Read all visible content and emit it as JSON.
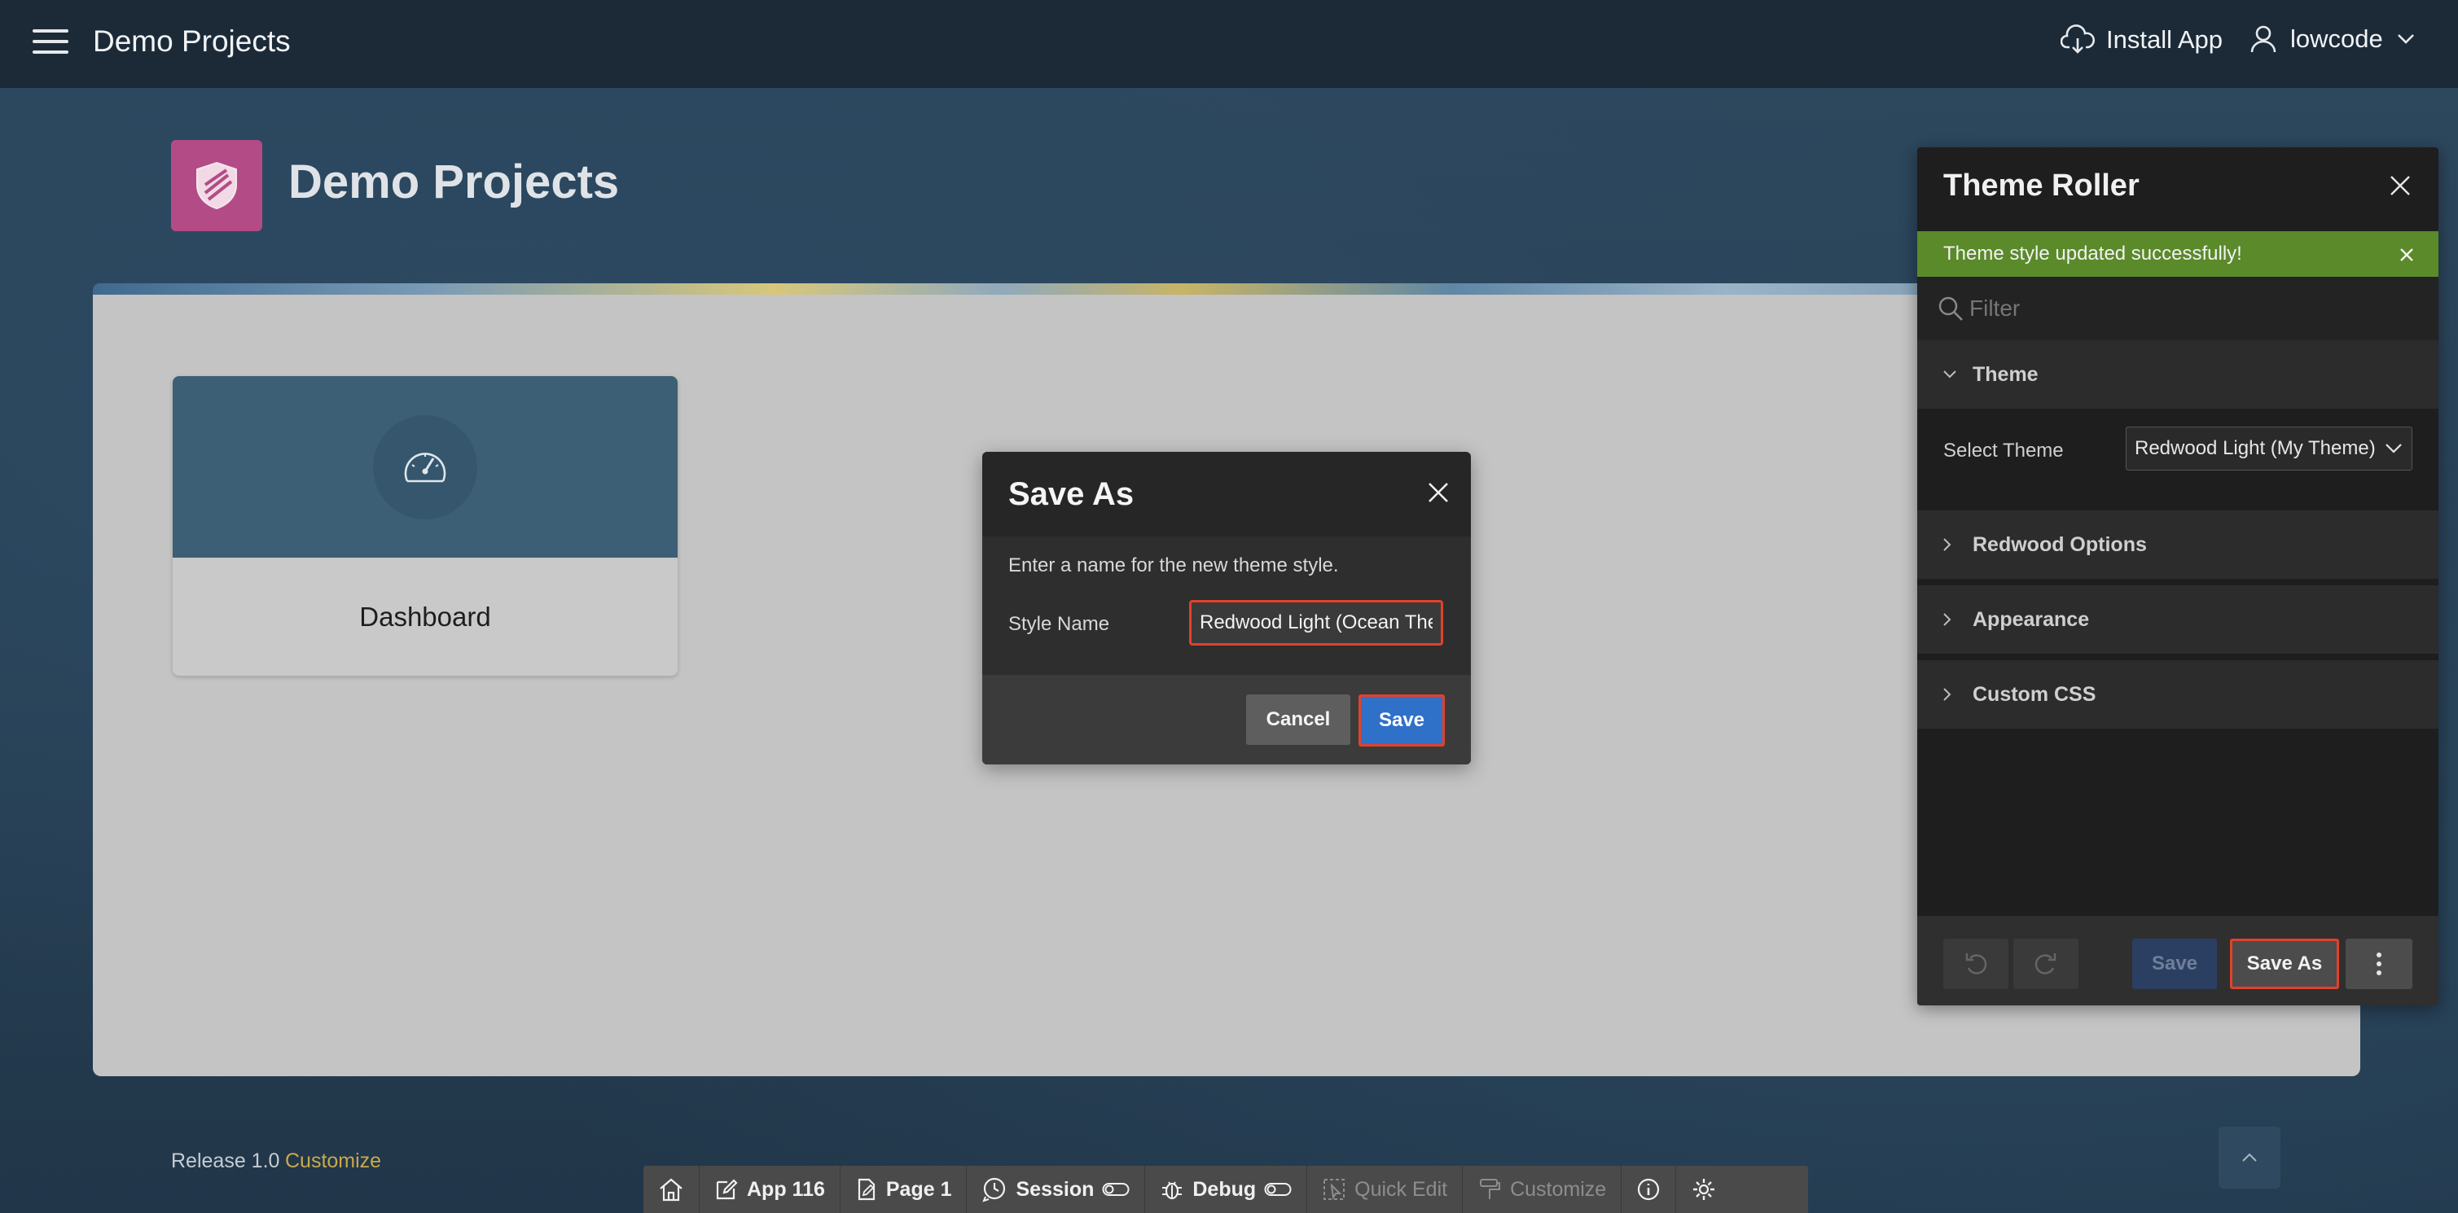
{
  "header": {
    "app_title": "Demo Projects",
    "install_app": "Install App",
    "username": "lowcode"
  },
  "page": {
    "title": "Demo Projects",
    "card_label": "Dashboard"
  },
  "footer": {
    "release": "Release 1.0",
    "customize": "Customize"
  },
  "dev_toolbar": {
    "app": "App 116",
    "page": "Page 1",
    "session": "Session",
    "debug": "Debug",
    "quick_edit": "Quick Edit",
    "customize": "Customize"
  },
  "dialog": {
    "title": "Save As",
    "description": "Enter a name for the new theme style.",
    "style_name_label": "Style Name",
    "style_name_value": "Redwood Light (Ocean Theme)",
    "cancel": "Cancel",
    "save": "Save"
  },
  "theme_roller": {
    "title": "Theme Roller",
    "alert": "Theme style updated successfully!",
    "filter_placeholder": "Filter",
    "sections": {
      "theme": "Theme",
      "redwood_options": "Redwood Options",
      "appearance": "Appearance",
      "custom_css": "Custom CSS"
    },
    "select_theme_label": "Select Theme",
    "select_theme_value": "Redwood Light (My Theme)",
    "footer": {
      "save": "Save",
      "save_as": "Save As"
    }
  },
  "colors": {
    "header_bg": "#1c2a38",
    "logo_tile": "#b34b86",
    "alert_success": "#5a8a2a",
    "primary_button": "#2f70c9",
    "highlight_border": "#e3412a",
    "footer_link": "#c9a94e"
  },
  "icons": {
    "hamburger": "hamburger-menu-icon",
    "install": "cloud-download-icon",
    "user": "user-icon",
    "logo": "shield-icon",
    "dashboard": "speedometer-icon",
    "close": "close-icon",
    "search": "search-icon",
    "chevron": "chevron-icon"
  }
}
